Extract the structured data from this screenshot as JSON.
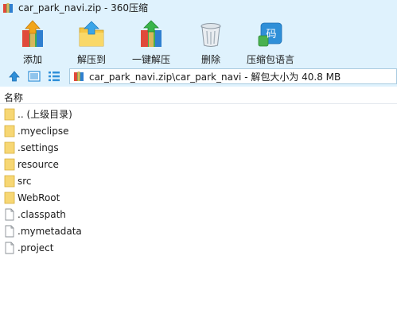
{
  "window": {
    "title": "car_park_navi.zip - 360压缩"
  },
  "toolbar": {
    "buttons": [
      {
        "label": "添加",
        "icon": "add-icon"
      },
      {
        "label": "解压到",
        "icon": "extract-to-icon"
      },
      {
        "label": "一键解压",
        "icon": "one-click-extract-icon"
      },
      {
        "label": "删除",
        "icon": "trash-icon"
      },
      {
        "label": "压缩包语言",
        "icon": "archive-language-icon",
        "icon_text": "码"
      }
    ]
  },
  "address_bar": {
    "path_text": "car_park_navi.zip\\car_park_navi - 解包大小为 40.8 MB"
  },
  "file_list": {
    "column_name": "名称",
    "items": [
      {
        "name": ".. (上级目录)",
        "type": "folder"
      },
      {
        "name": ".myeclipse",
        "type": "folder"
      },
      {
        "name": ".settings",
        "type": "folder"
      },
      {
        "name": "resource",
        "type": "folder"
      },
      {
        "name": "src",
        "type": "folder"
      },
      {
        "name": "WebRoot",
        "type": "folder"
      },
      {
        "name": ".classpath",
        "type": "file"
      },
      {
        "name": ".mymetadata",
        "type": "file"
      },
      {
        "name": ".project",
        "type": "file"
      }
    ]
  },
  "colors": {
    "chrome_background": "#dff2fd",
    "folder_yellow": "#f7d774",
    "accent_blue": "#2f8fd8"
  }
}
